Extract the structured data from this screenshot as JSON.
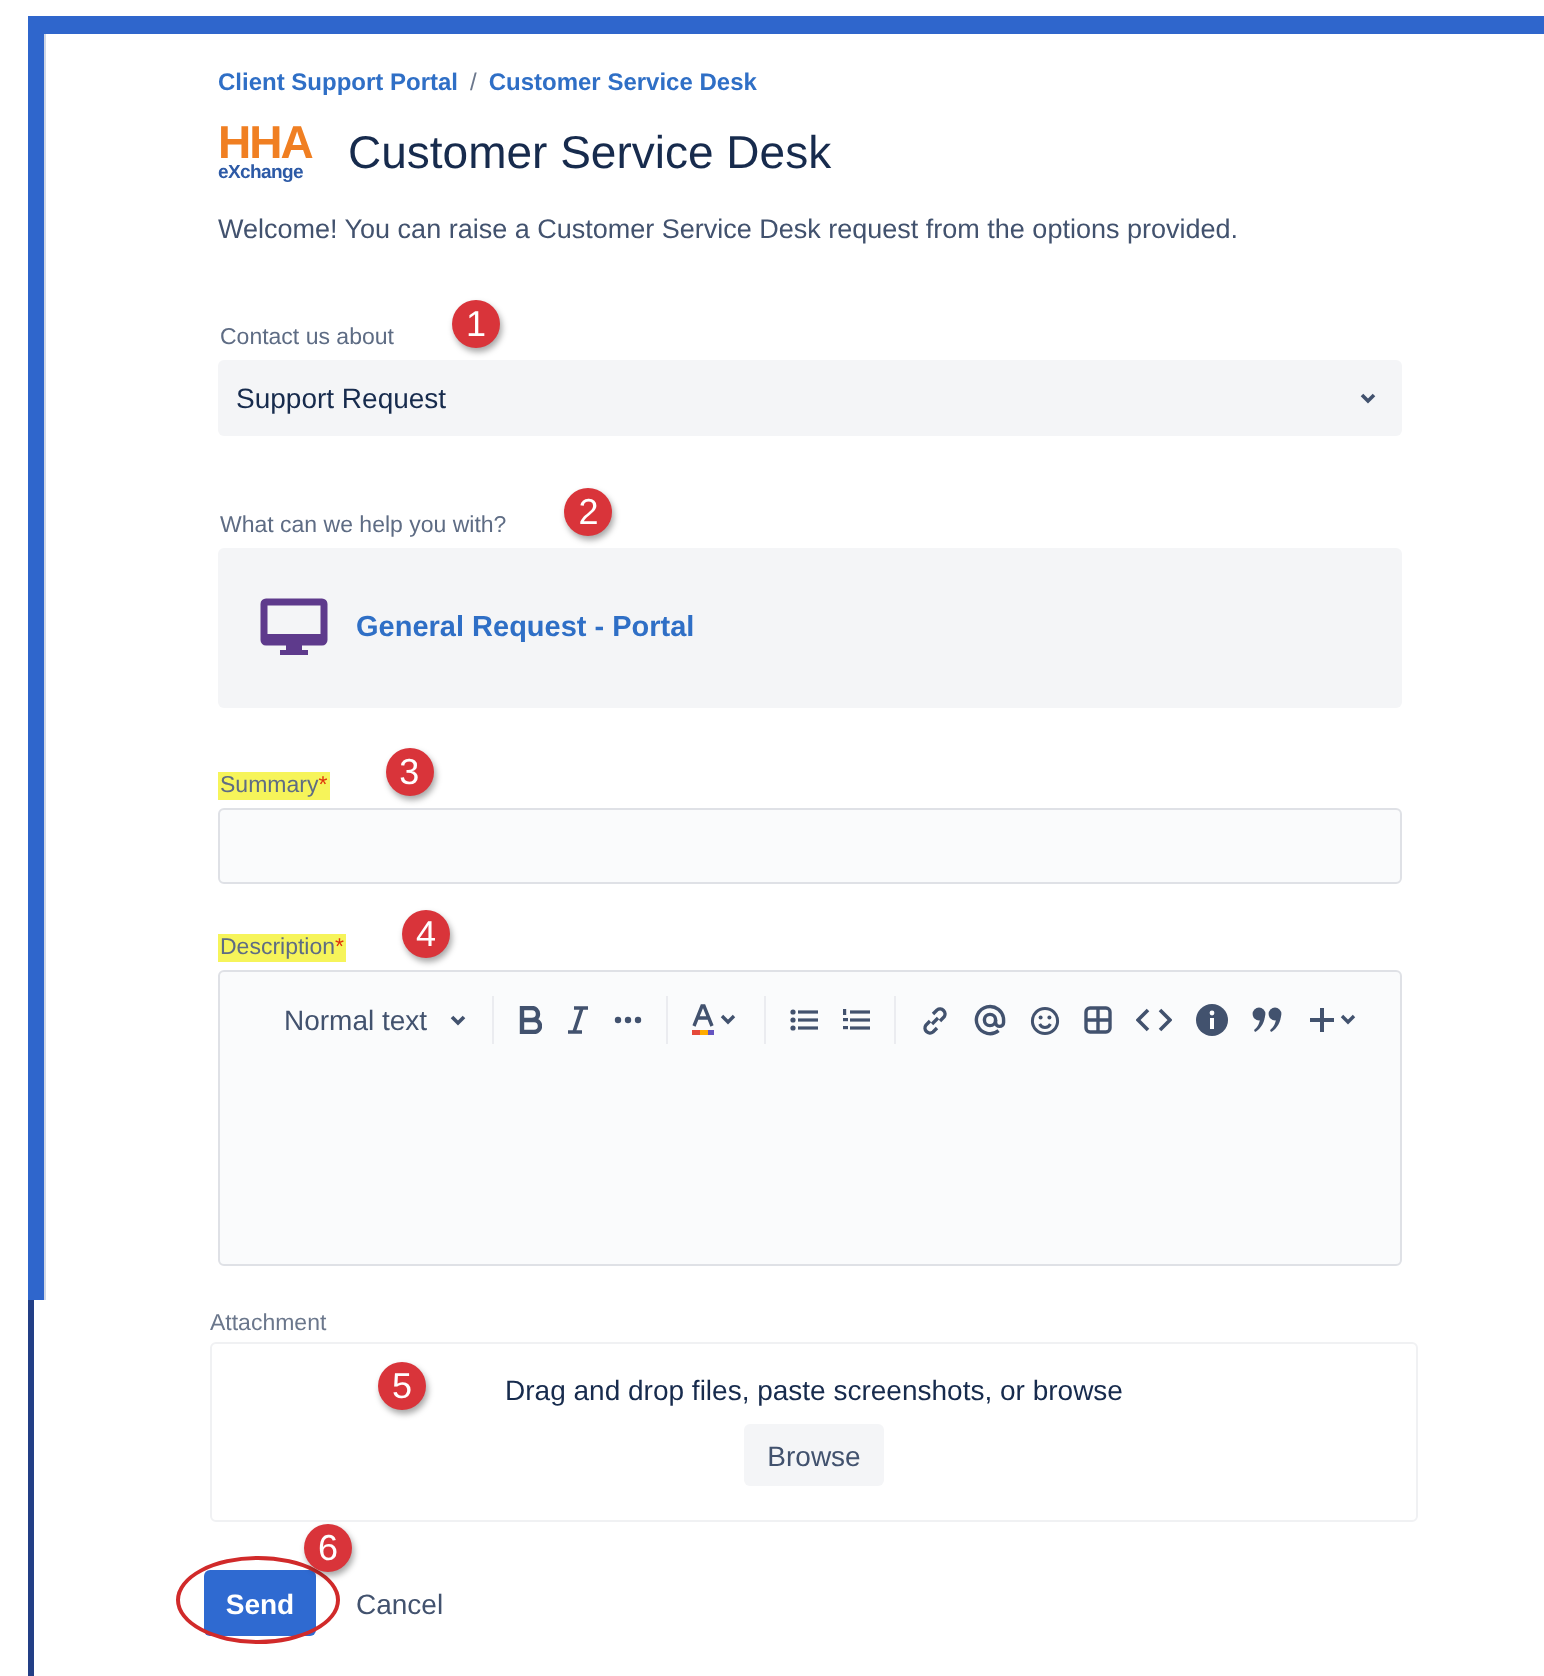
{
  "breadcrumbs": [
    {
      "label": "Client Support Portal"
    },
    {
      "label": "Customer Service Desk"
    }
  ],
  "breadcrumb_separator": "/",
  "logo": {
    "top": "HHA",
    "bottom": "eXchange"
  },
  "title": "Customer Service Desk",
  "welcome": "Welcome! You can raise a Customer Service Desk request from the options provided.",
  "fields": [
    {
      "kind": "select",
      "label": "Contact us about",
      "value": "Support Request",
      "highlighted": false,
      "callout": "1"
    },
    {
      "kind": "request_type",
      "label": "What can we help you with?",
      "value": "General Request - Portal",
      "highlighted": false,
      "callout": "2"
    },
    {
      "kind": "text",
      "label": "Summary",
      "required_mark": "*",
      "highlighted": true,
      "callout": "3"
    },
    {
      "kind": "editor",
      "label": "Description",
      "required_mark": "*",
      "highlighted": true,
      "callout": "4",
      "style_menu": "Normal text"
    },
    {
      "kind": "attachment",
      "label": "Attachment",
      "highlighted": false,
      "callout": "5",
      "prompt": "Drag and drop files, paste screenshots, or browse",
      "button": "Browse"
    }
  ],
  "actions": {
    "submit": {
      "label": "Send",
      "circled": true,
      "callout": "6"
    },
    "cancel": "Cancel"
  }
}
